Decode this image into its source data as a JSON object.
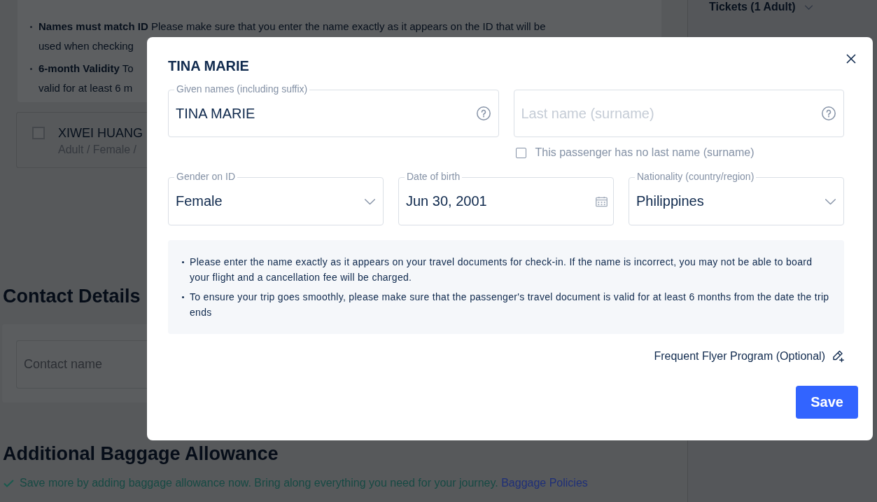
{
  "page": {
    "notice": [
      {
        "lines": [
          "**Names must match ID** Please make sure that you enter the name exactly as it appears on the ID that will be",
          "used when checking"
        ]
      },
      {
        "lines": [
          "**6-month Validity** To",
          "valid for at least 6 m"
        ]
      }
    ],
    "passenger": {
      "checked": false,
      "name": "XIWEI HUANG",
      "details": "Adult / Female /"
    },
    "contact": {
      "heading": "Contact Details",
      "name_field": {
        "placeholder": "Contact name"
      }
    },
    "baggage": {
      "heading": "Additional Baggage Allowance",
      "text": "Save more by adding baggage allowance now. Bring along everything you need for your journey.",
      "link": "Baggage Policies"
    },
    "sidebar": {
      "tickets": "Tickets (1 Adult)"
    }
  },
  "dialog": {
    "title": "TINA MARIE",
    "name_fields": [
      {
        "kind": "text",
        "label": "Given names (including suffix)",
        "value": "TINA MARIE"
      },
      {
        "kind": "text",
        "placeholder": "Last name (surname)"
      }
    ],
    "no_last_name": {
      "label": "This passenger has no last name (surname)",
      "checked": false
    },
    "detail_fields": [
      {
        "kind": "select",
        "label": "Gender on ID",
        "value": "Female"
      },
      {
        "kind": "date",
        "label": "Date of birth",
        "value": "Jun 30, 2001"
      },
      {
        "kind": "select",
        "label": "Nationality (country/region)",
        "value": "Philippines"
      }
    ],
    "notes": [
      "Please enter the name exactly as it appears on your travel documents for check-in. If the name is incorrect, you may not be able to board your flight and a cancellation fee will be charged.",
      "To ensure your trip goes smoothly, please make sure that the passenger's travel document is valid for at least 6 months from the date the trip ends"
    ],
    "frequent_flyer": "Frequent Flyer Program (Optional)",
    "save_button": "Save"
  }
}
